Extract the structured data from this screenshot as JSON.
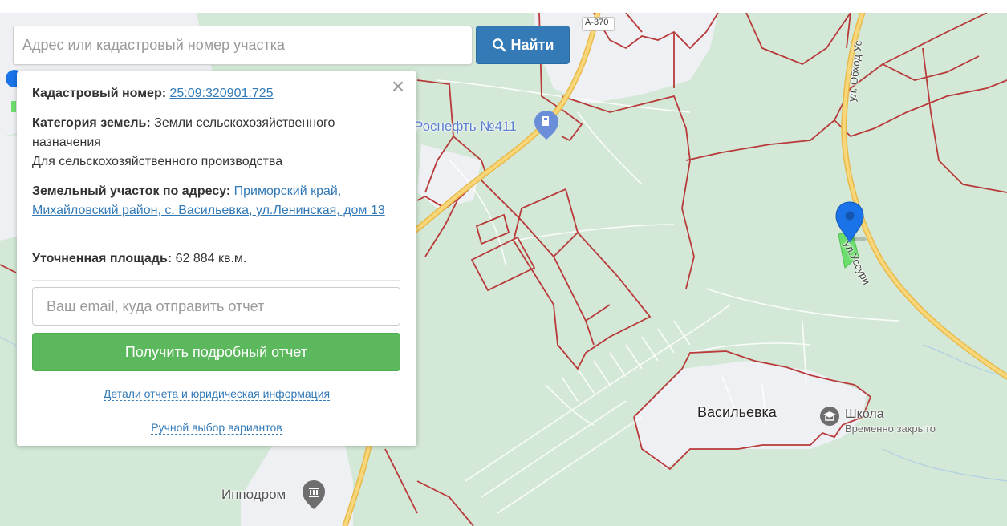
{
  "search": {
    "placeholder": "Адрес или кадастровый номер участка",
    "button_label": "Найти",
    "button_icon": "search-icon"
  },
  "popup": {
    "cadastre_label": "Кадастровый номер:",
    "cadastre_value": "25:09:320901:725",
    "category_label": "Категория земель:",
    "category_value": "Земли сельскохозяйственного назначения",
    "usage": "Для сельскохозяйственного производства",
    "address_label": "Земельный участок по адресу:",
    "address_value": "Приморский край, Михайловский район, с. Васильевка, ул.Ленинская, дом 13",
    "area_label": "Уточненная площадь:",
    "area_value": "62 884 кв.м.",
    "email_placeholder": "Ваш email, куда отправить отчет",
    "report_button": "Получить подробный отчет",
    "details_link": "Детали отчета и юридическая информация",
    "manual_link": "Ручной выбор вариантов",
    "close_icon": "close-icon"
  },
  "map": {
    "labels": {
      "road_a370": "А-370",
      "gas_station": "Роснефть №411",
      "street_bypass": "ул. Обход Ус",
      "street_ussuri": "ул.Уссури",
      "village": "Васильевка",
      "school": "Школа",
      "school_status": "Временно закрыто",
      "hippodrome": "Ипподром"
    },
    "colors": {
      "background": "#d3e8d6",
      "town": "#eef0f3",
      "parcel_border": "#b83a3a",
      "major_road": "#f2c95c",
      "minor_road": "#ffffff",
      "marker": "#1a73e8",
      "parcel_fill": "#6dde6d",
      "poi_blue": "#6a8fd8",
      "poi_gray": "#6e6e6e"
    }
  }
}
